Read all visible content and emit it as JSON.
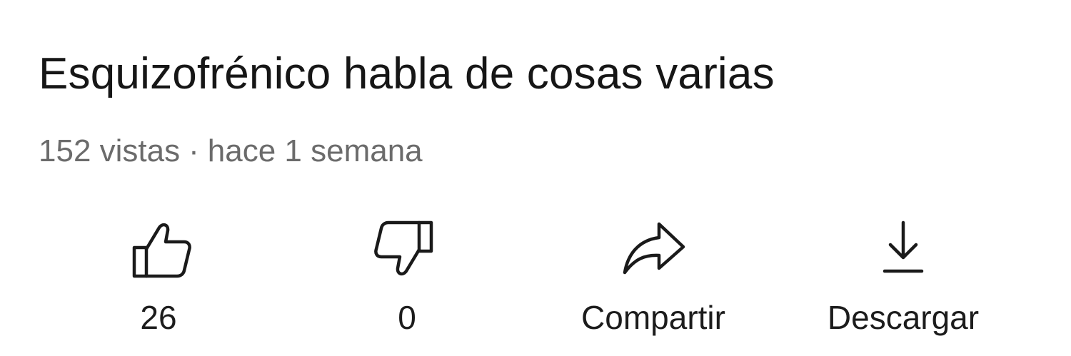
{
  "video": {
    "title": "Esquizofrénico habla de cosas varias",
    "views": "152 vistas",
    "separator": "·",
    "published": "hace 1 semana"
  },
  "actions": {
    "like": {
      "icon": "thumbs-up-icon",
      "label": "26"
    },
    "dislike": {
      "icon": "thumbs-down-icon",
      "label": "0"
    },
    "share": {
      "icon": "share-arrow-icon",
      "label": "Compartir"
    },
    "download": {
      "icon": "download-icon",
      "label": "Descargar"
    }
  },
  "colors": {
    "background": "#ffffff",
    "title_text": "#161616",
    "meta_text": "#6b6b6b",
    "icon_stroke": "#1a1a1a"
  }
}
